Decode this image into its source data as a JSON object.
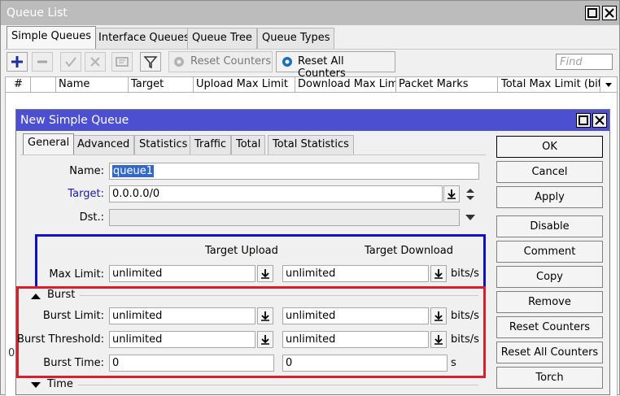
{
  "outer": {
    "title": "Queue List",
    "tabs": [
      "Simple Queues",
      "Interface Queues",
      "Queue Tree",
      "Queue Types"
    ],
    "toolbar": {
      "reset_counters": "Reset Counters",
      "reset_all_counters": "Reset All Counters",
      "find_placeholder": "Find"
    },
    "columns": [
      "#",
      "",
      "Name",
      "Target",
      "Upload Max Limit",
      "Download Max Limit",
      "Packet Marks",
      "Total Max Limit (bit..."
    ],
    "peek_char": "0"
  },
  "dialog": {
    "title": "New Simple Queue",
    "tabs": [
      "General",
      "Advanced",
      "Statistics",
      "Traffic",
      "Total",
      "Total Statistics"
    ],
    "labels": {
      "name": "Name:",
      "target": "Target:",
      "dst": "Dst.:",
      "target_upload": "Target Upload",
      "target_download": "Target Download",
      "max_limit": "Max Limit:",
      "burst_section": "Burst",
      "burst_limit": "Burst Limit:",
      "burst_threshold": "Burst Threshold:",
      "burst_time": "Burst Time:",
      "time_section": "Time",
      "unit_bits": "bits/s",
      "unit_s": "s"
    },
    "values": {
      "name": "queue1",
      "target": "0.0.0.0/0",
      "dst": "",
      "max_limit_upload": "unlimited",
      "max_limit_download": "unlimited",
      "burst_limit_upload": "unlimited",
      "burst_limit_download": "unlimited",
      "burst_threshold_upload": "unlimited",
      "burst_threshold_download": "unlimited",
      "burst_time_upload": "0",
      "burst_time_download": "0"
    },
    "buttons": [
      "OK",
      "Cancel",
      "Apply",
      "Disable",
      "Comment",
      "Copy",
      "Remove",
      "Reset Counters",
      "Reset All Counters",
      "Torch"
    ]
  },
  "colors": {
    "dialog_title_bar": "#4b4fd0",
    "highlight_blue": "#1010c8",
    "highlight_red": "#d8202c",
    "link_blue": "#1a1aa8"
  }
}
